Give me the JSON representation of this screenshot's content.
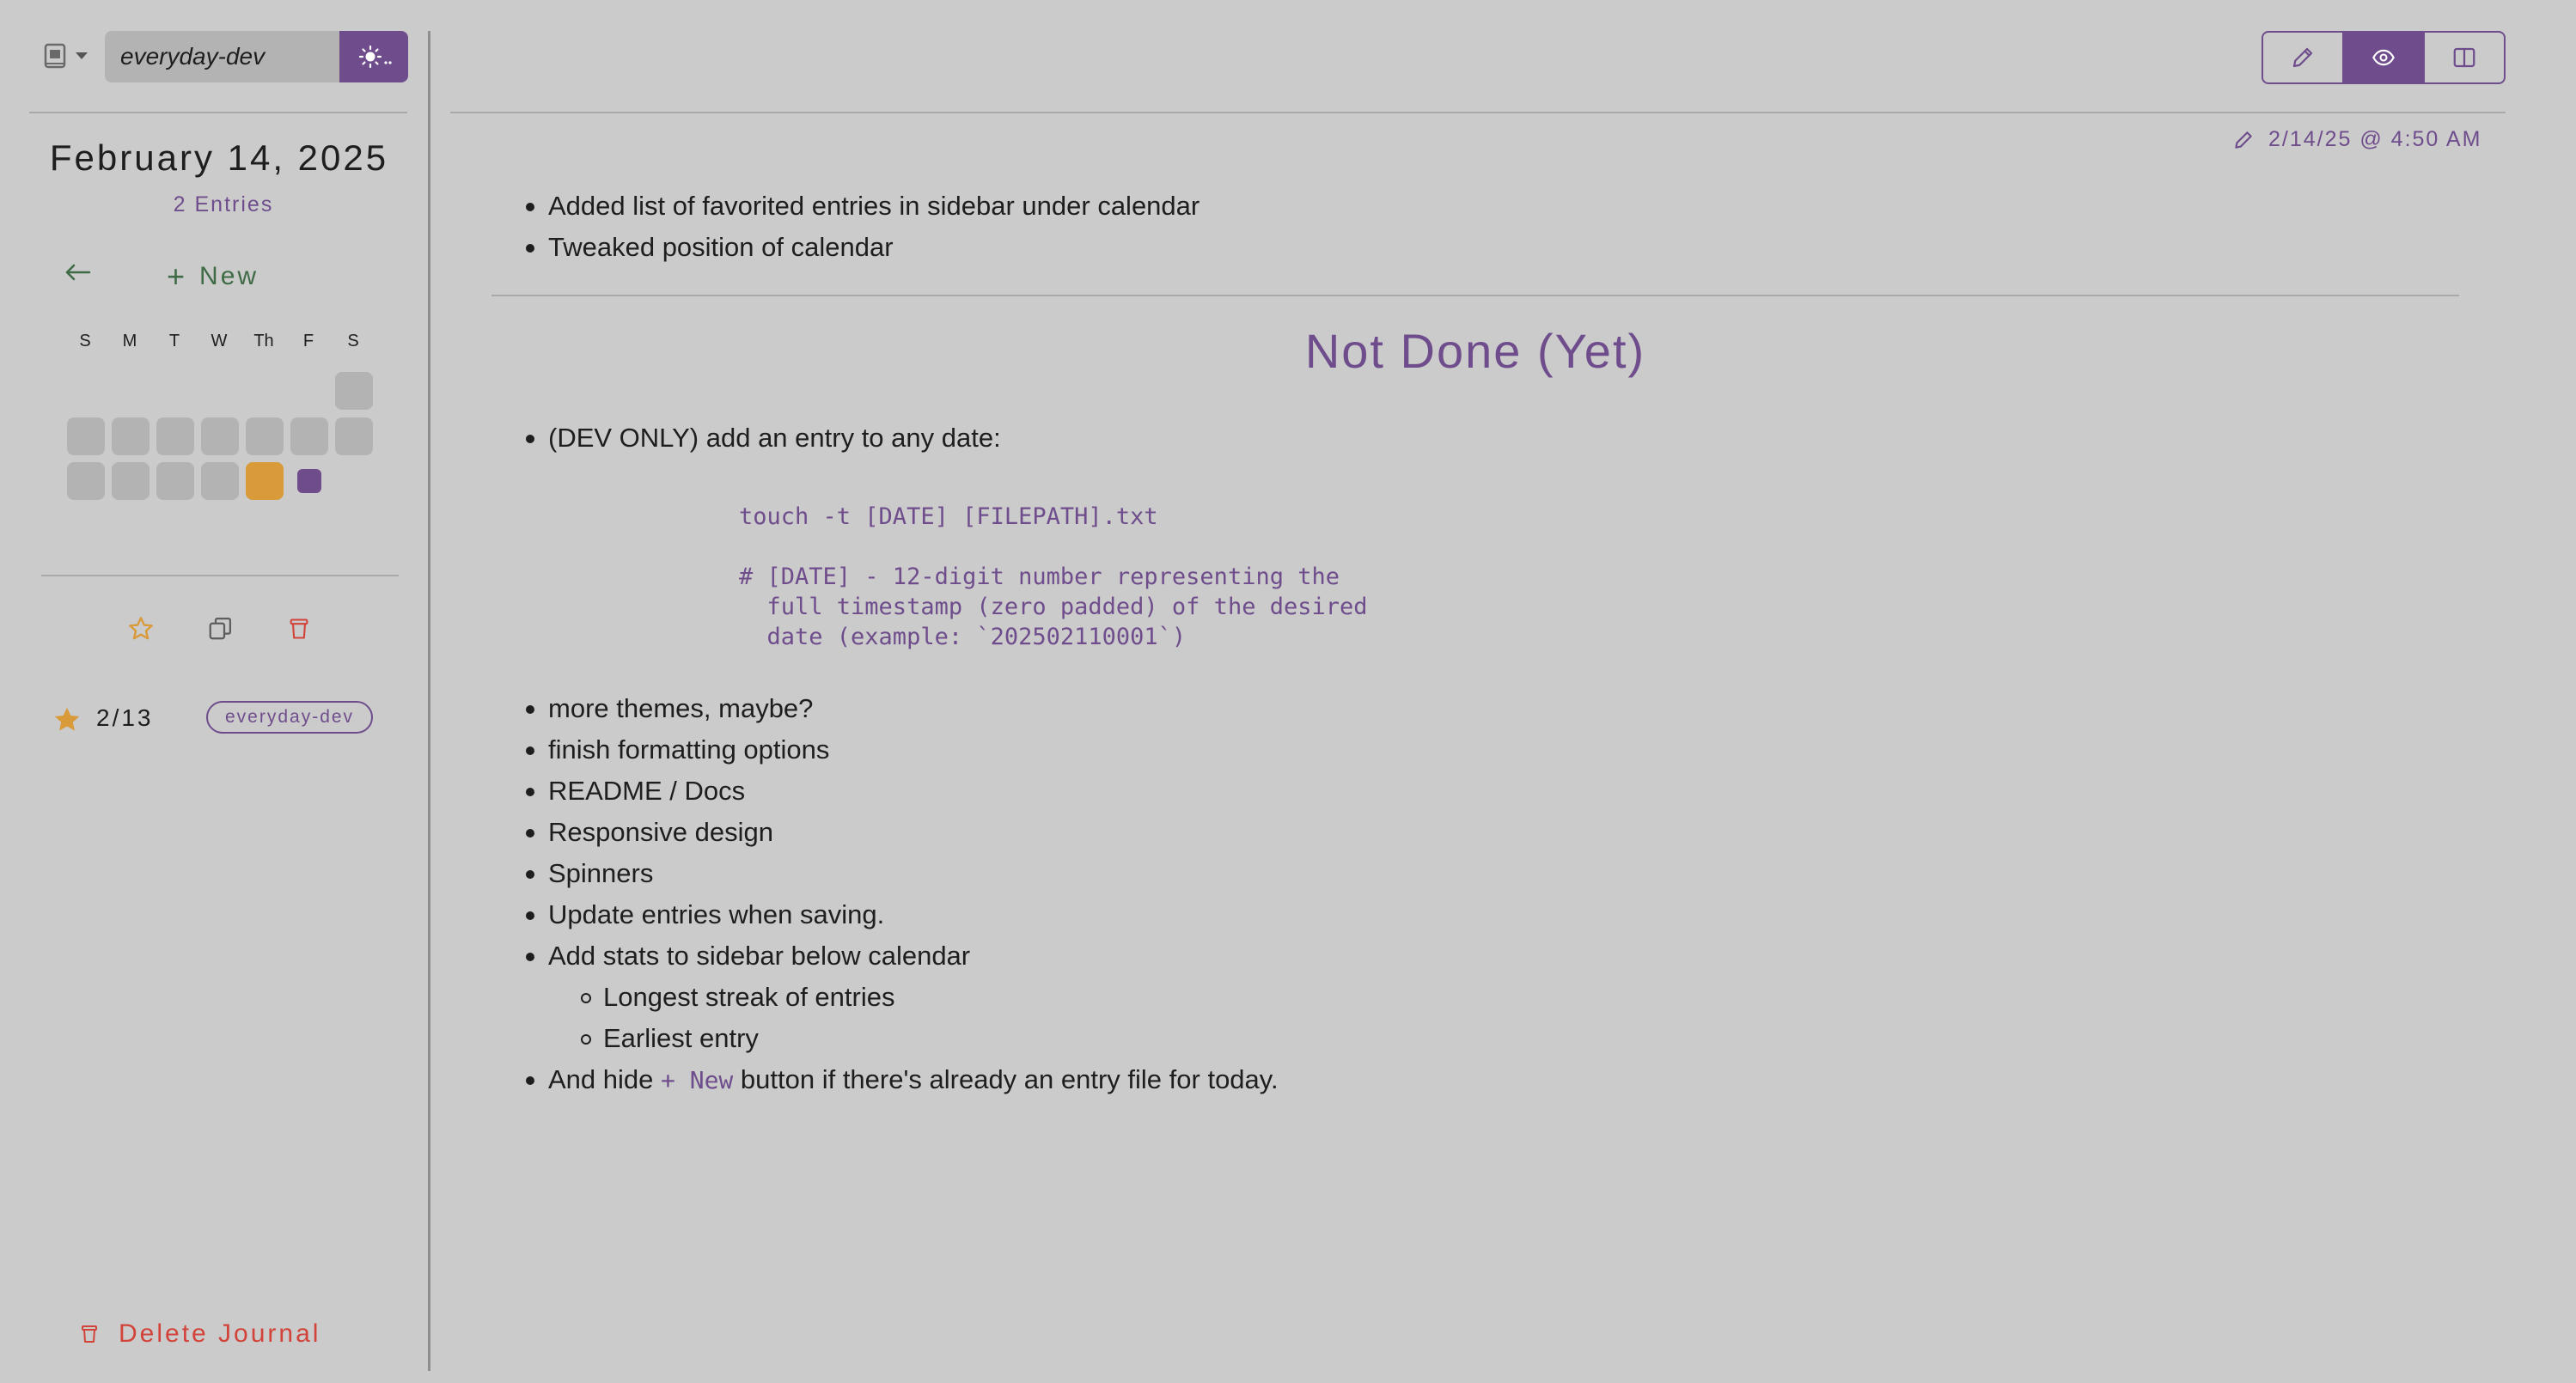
{
  "sidebar": {
    "journal_name": "everyday-dev",
    "date_title": "February 14, 2025",
    "entries_count": "2 Entries",
    "new_label": "New",
    "weekdays": [
      "S",
      "M",
      "T",
      "W",
      "Th",
      "F",
      "S"
    ],
    "favorites": [
      {
        "date": "2/13",
        "tag": "everyday-dev"
      }
    ],
    "delete_journal_label": "Delete Journal"
  },
  "entry": {
    "timestamp": "2/14/25 @ 4:50 AM",
    "done_items": [
      "Added list of favorited entries in sidebar under calendar",
      "Tweaked position of calendar"
    ],
    "section_heading": "Not Done (Yet)",
    "dev_item": "(DEV ONLY) add an entry to any date:",
    "code_block": "touch -t [DATE] [FILEPATH].txt\n\n# [DATE] - 12-digit number representing the\n  full timestamp (zero padded) of the desired\n  date (example: `202502110001`)",
    "todo_items": [
      "more themes, maybe?",
      "finish formatting options",
      "README / Docs",
      "Responsive design",
      "Spinners",
      "Update entries when saving.",
      "Add stats to sidebar below calendar"
    ],
    "stats_subitems": [
      "Longest streak of entries",
      "Earliest entry"
    ],
    "hide_item": {
      "before": "And hide ",
      "code": "+ New",
      "after": " button if there's already an entry file for today."
    }
  },
  "colors": {
    "accent": "#6f4d8c",
    "today": "#d99a3a",
    "danger": "#d2433a",
    "new_green": "#3e6b45",
    "background": "#cbcbcb"
  },
  "icons": {
    "journal_menu": "journal-icon",
    "theme": "sun-icon",
    "favorite": "star-icon",
    "copy": "copy-icon",
    "delete": "trash-icon",
    "edit_mode": "pencil-icon",
    "preview_mode": "eye-icon",
    "split_mode": "columns-icon"
  }
}
